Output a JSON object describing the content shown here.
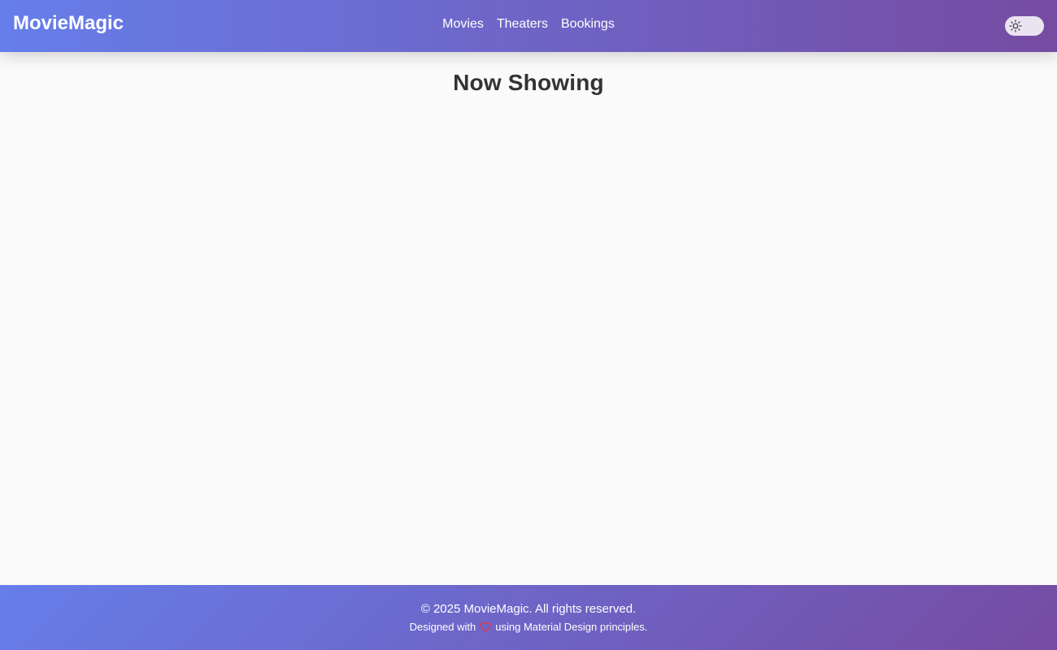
{
  "header": {
    "brand": "MovieMagic",
    "nav": [
      {
        "label": "Movies"
      },
      {
        "label": "Theaters"
      },
      {
        "label": "Bookings"
      }
    ],
    "theme_toggle_icon": "sun-icon"
  },
  "main": {
    "title": "Now Showing"
  },
  "footer": {
    "copyright": "© 2025 MovieMagic. All rights reserved.",
    "designed_prefix": "Designed with",
    "designed_icon": "heart-icon",
    "designed_suffix": "using Material Design principles."
  },
  "colors": {
    "gradient_start": "#667eea",
    "gradient_end": "#764ba2",
    "background": "#fafafa",
    "heart": "#e53935"
  }
}
